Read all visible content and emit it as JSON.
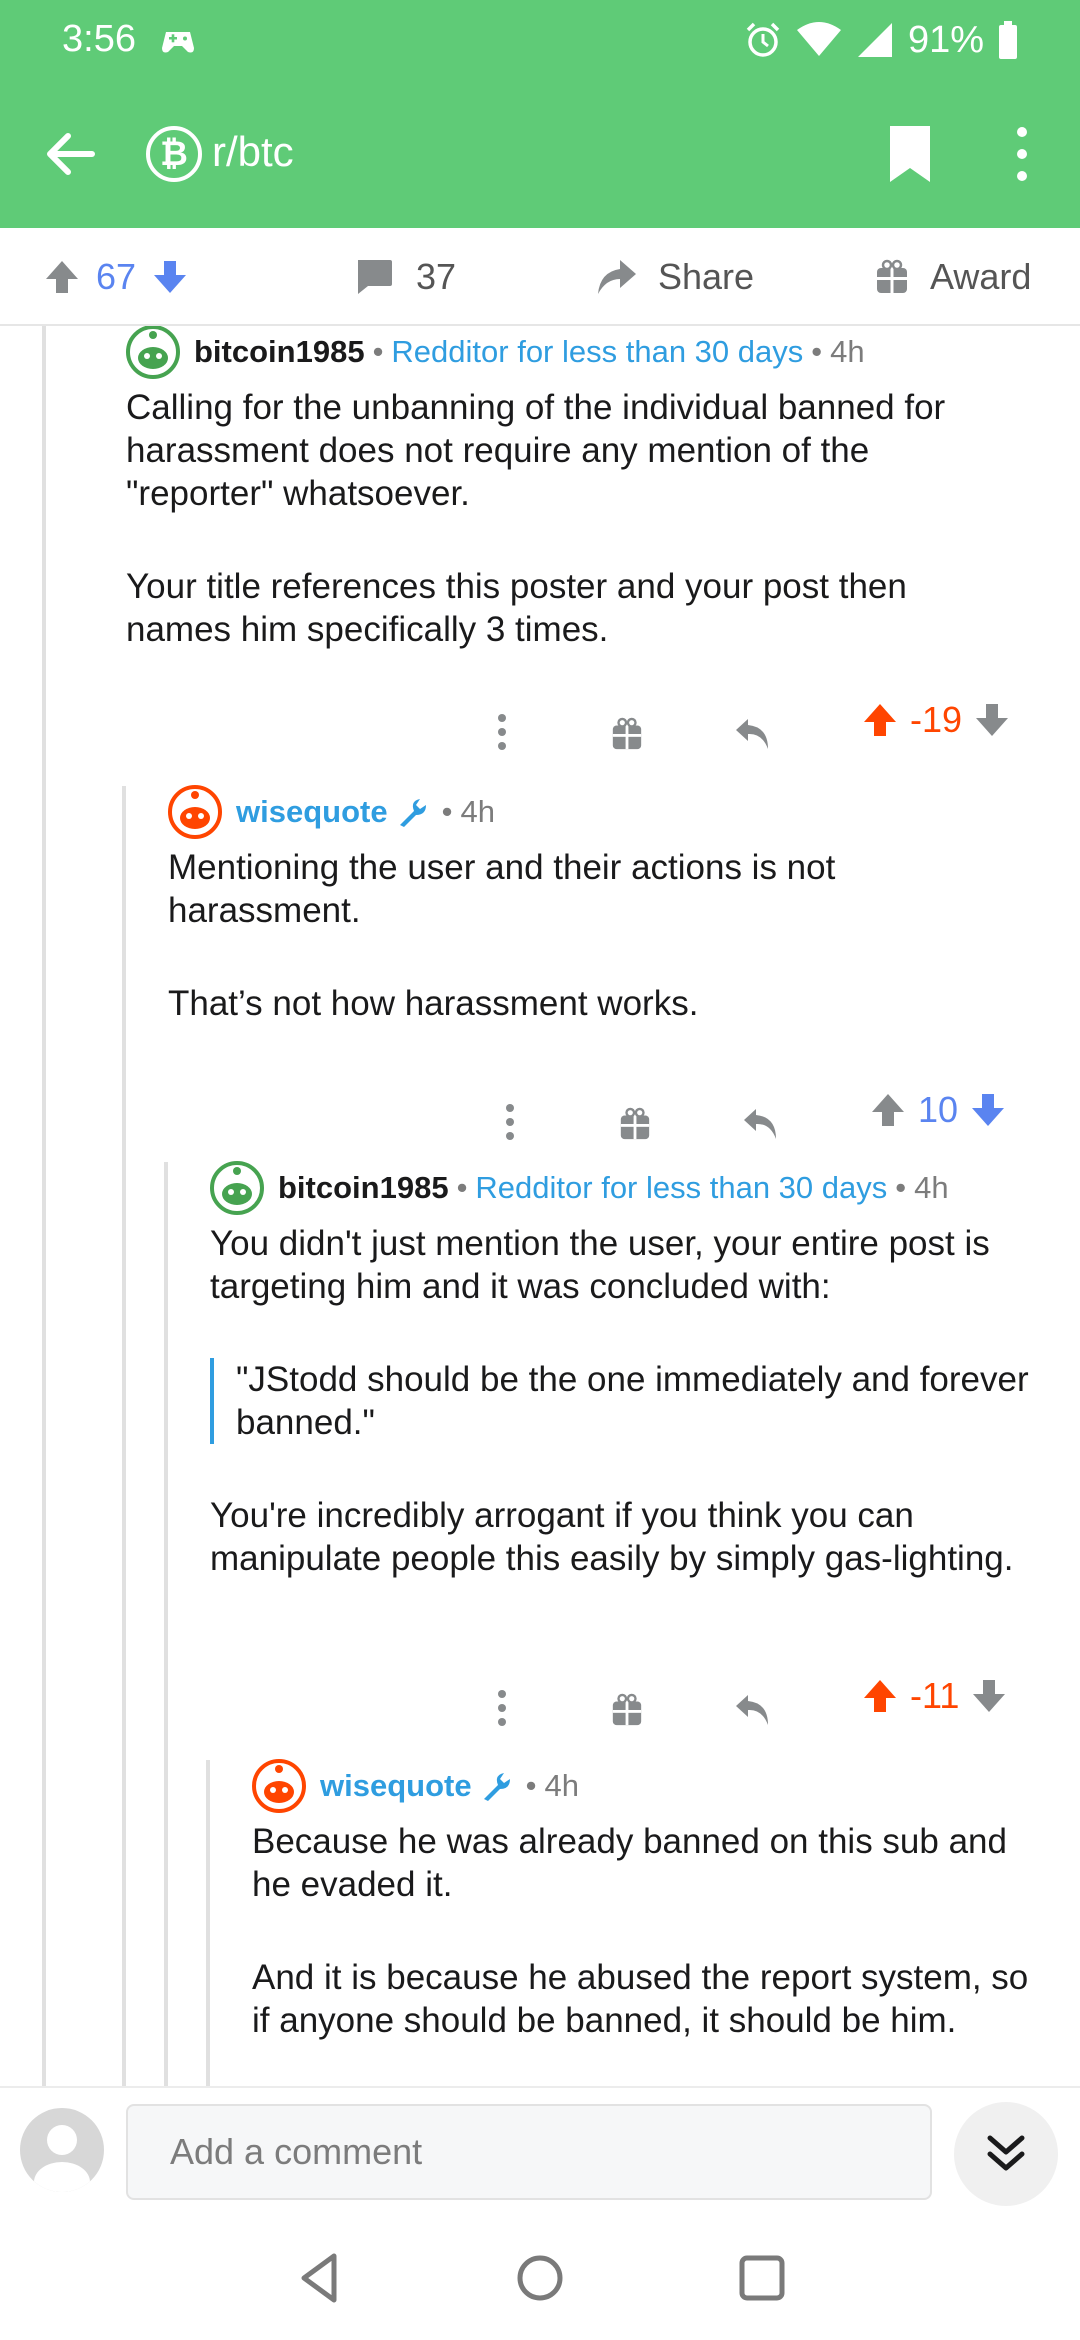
{
  "status_bar": {
    "time": "3:56",
    "battery": "91%"
  },
  "header": {
    "subreddit_icon_letter": "₿",
    "subreddit": "r/btc"
  },
  "action_bar": {
    "score": "67",
    "comments": "37",
    "share_label": "Share",
    "award_label": "Award"
  },
  "comments": [
    {
      "author": "bitcoin1985",
      "flair": "Redditor for less than 30 days",
      "age": "4h",
      "paragraphs": [
        "Calling for the unbanning of the individual banned for harassment does not require any mention of the \"reporter\" whatsoever.",
        "Your title references this poster and your post then names him specifically 3 times."
      ],
      "score": "-19"
    },
    {
      "author": "wisequote",
      "age": "4h",
      "paragraphs": [
        "Mentioning the user and their actions is not harassment.",
        "That’s not how harassment works."
      ],
      "score": "10"
    },
    {
      "author": "bitcoin1985",
      "flair": "Redditor for less than 30 days",
      "age": "4h",
      "paragraphs": [
        "You didn't just mention the user, your entire post is targeting him and it was concluded with:",
        "You're incredibly arrogant if you think you can manipulate people this easily by simply gas-lighting."
      ],
      "quote": "\"JStodd should be the one immediately and forever banned.\"",
      "score": "-11"
    },
    {
      "author": "wisequote",
      "age": "4h",
      "paragraphs": [
        "Because he was already banned on this sub and he evaded it.",
        "And it is because he abused the report system, so if anyone should be banned, it should be him."
      ]
    }
  ],
  "comment_bar": {
    "placeholder": "Add a comment"
  },
  "colors": {
    "header_green": "#5fcb77",
    "upvote_orange": "#ff4500",
    "downvote_blue": "#5a84f0",
    "mod_blue": "#2f9de0"
  },
  "icons": [
    "back-arrow-icon",
    "bitcoin-icon",
    "bookmark-icon",
    "more-vertical-icon",
    "upvote-icon",
    "downvote-icon",
    "comment-icon",
    "share-icon",
    "gift-icon",
    "reply-icon",
    "moderator-wrench-icon",
    "chevron-double-down-icon"
  ]
}
